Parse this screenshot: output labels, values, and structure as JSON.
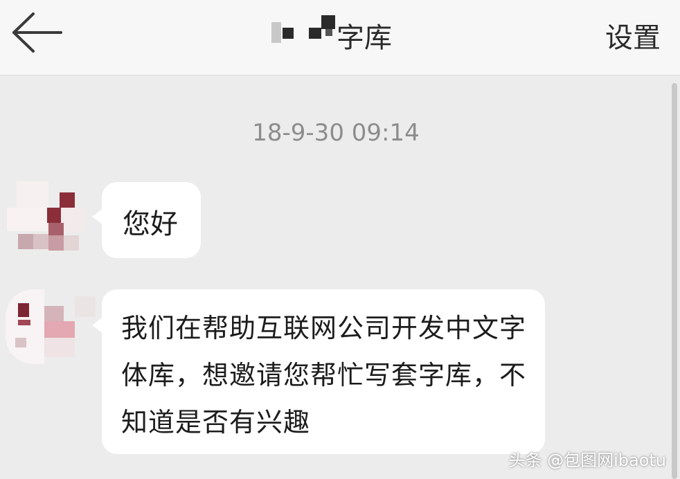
{
  "header": {
    "title_suffix": "字库",
    "settings_label": "设置"
  },
  "chat": {
    "timestamp": "18-9-30 09:14",
    "messages": [
      {
        "text": "您好"
      },
      {
        "text": "我们在帮助互联网公司开发中文字体库，想邀请您帮忙写套字库，不知道是否有兴趣"
      }
    ]
  },
  "watermark": "头条 @包图网ibaotu",
  "icons": {
    "back": "arrow-left-icon"
  },
  "colors": {
    "background": "#ececec",
    "header": "#f7f7f7",
    "bubble": "#ffffff",
    "avatar_accent": "#8b2e3a"
  }
}
